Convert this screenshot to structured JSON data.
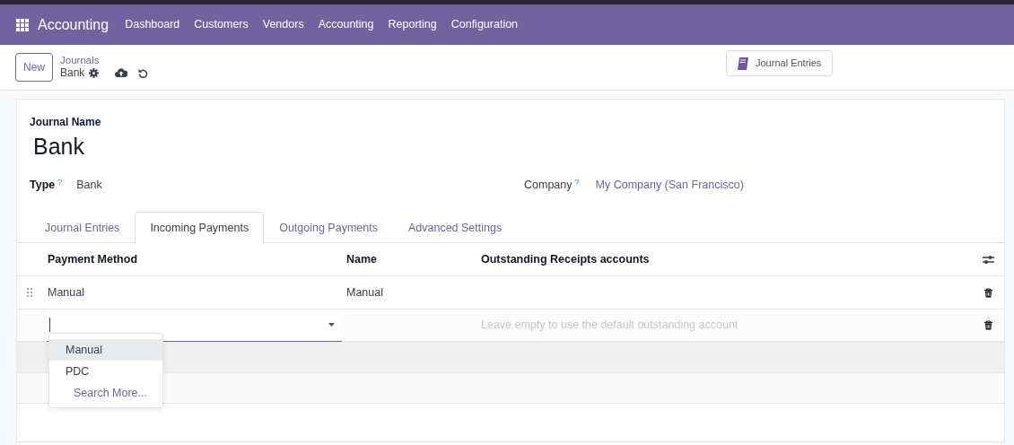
{
  "navbar": {
    "app": "Accounting",
    "menu": [
      "Dashboard",
      "Customers",
      "Vendors",
      "Accounting",
      "Reporting",
      "Configuration"
    ]
  },
  "control_panel": {
    "new_button": "New",
    "breadcrumb": "Journals",
    "record": "Bank",
    "smart_button": "Journal Entries"
  },
  "form": {
    "name_label": "Journal Name",
    "name": "Bank",
    "fields": [
      {
        "label": "Type",
        "help": "?",
        "value": "Bank",
        "kind": "text"
      },
      {
        "label": "Company",
        "help": "?",
        "value": "My Company (San Francisco)",
        "kind": "link"
      }
    ],
    "tabs": [
      {
        "label": "Journal Entries",
        "selected": false
      },
      {
        "label": "Incoming Payments",
        "selected": true
      },
      {
        "label": "Outgoing Payments",
        "selected": false
      },
      {
        "label": "Advanced Settings",
        "selected": false
      }
    ],
    "table": {
      "columns": [
        "Payment Method",
        "Name",
        "Outstanding Receipts accounts"
      ],
      "rows": [
        {
          "payment_method": "Manual",
          "name": "Manual"
        }
      ],
      "new_row": {
        "placeholder": "Leave empty to use the default outstanding account"
      },
      "dropdown": {
        "options": [
          {
            "label": "Manual",
            "selected": true
          },
          {
            "label": "PDC",
            "selected": false
          }
        ],
        "search_more": "Search More..."
      }
    }
  }
}
